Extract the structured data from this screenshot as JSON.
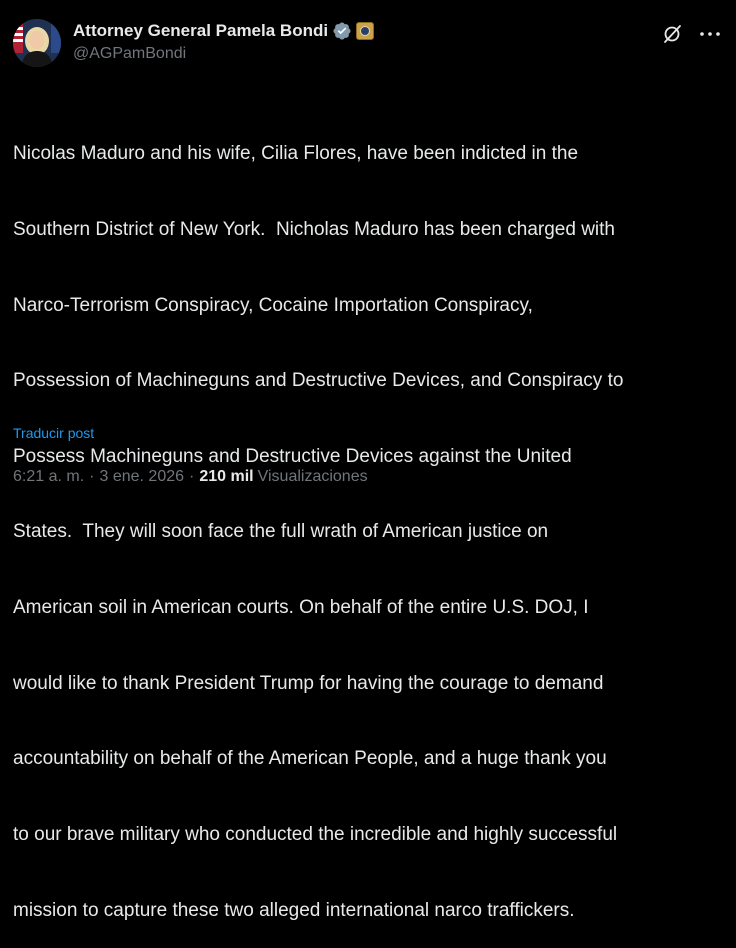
{
  "author": {
    "display_name": "Attorney General Pamela Bondi",
    "handle": "@AGPamBondi",
    "verified_color": "#829aab",
    "avatar_icon": "profile-photo-with-flags",
    "affiliate_badge_icon": "doj-seal-badge"
  },
  "toolbar": {
    "grok_icon": "grok-slash-icon",
    "more_icon": "more-dots-icon"
  },
  "tweet": {
    "lines": [
      "Nicolas Maduro and his wife, Cilia Flores, have been indicted in the",
      "Southern District of New York.  Nicholas Maduro has been charged with",
      "Narco-Terrorism Conspiracy, Cocaine Importation Conspiracy,",
      "Possession of Machineguns and Destructive Devices, and Conspiracy to",
      "Possess Machineguns and Destructive Devices against the United",
      "States.  They will soon face the full wrath of American justice on",
      "American soil in American courts. On behalf of the entire U.S. DOJ, I",
      "would like to thank President Trump for having the courage to demand",
      "accountability on behalf of the American People, and a huge thank you",
      "to our brave military who conducted the incredible and highly successful",
      "mission to capture these two alleged international narco traffickers."
    ],
    "translate_label": "Traducir post"
  },
  "meta": {
    "time": "6:21 a. m.",
    "separator": "·",
    "date": "3 ene. 2026",
    "views_count": "210 mil",
    "views_label": "Visualizaciones"
  },
  "colors": {
    "background": "#000000",
    "text_primary": "#e7e9ea",
    "text_secondary": "#71767b",
    "link": "#1d9bf0"
  }
}
